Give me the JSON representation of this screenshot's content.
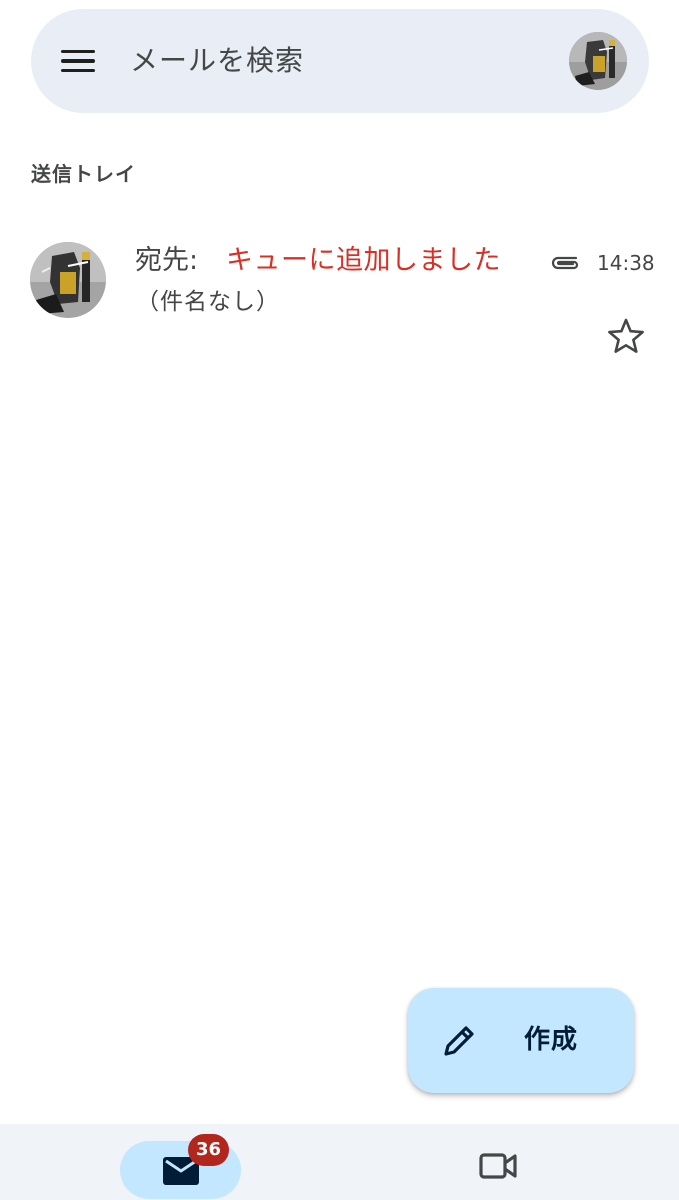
{
  "search": {
    "placeholder": "メールを検索"
  },
  "folder": {
    "title": "送信トレイ"
  },
  "email": {
    "to_label": "宛先:",
    "status": "キューに追加しました",
    "time": "14:38",
    "subject": "（件名なし）"
  },
  "compose": {
    "label": "作成"
  },
  "bottom_nav": {
    "mail_badge": "36"
  },
  "colors": {
    "search_bg": "#e9eef6",
    "status_red": "#d93025",
    "fab_bg": "#c2e7ff",
    "badge_red": "#b3261e",
    "nav_bg": "#f0f4f9"
  },
  "icons": [
    "menu-icon",
    "attachment-icon",
    "star-icon",
    "pencil-icon",
    "mail-icon",
    "video-icon"
  ]
}
